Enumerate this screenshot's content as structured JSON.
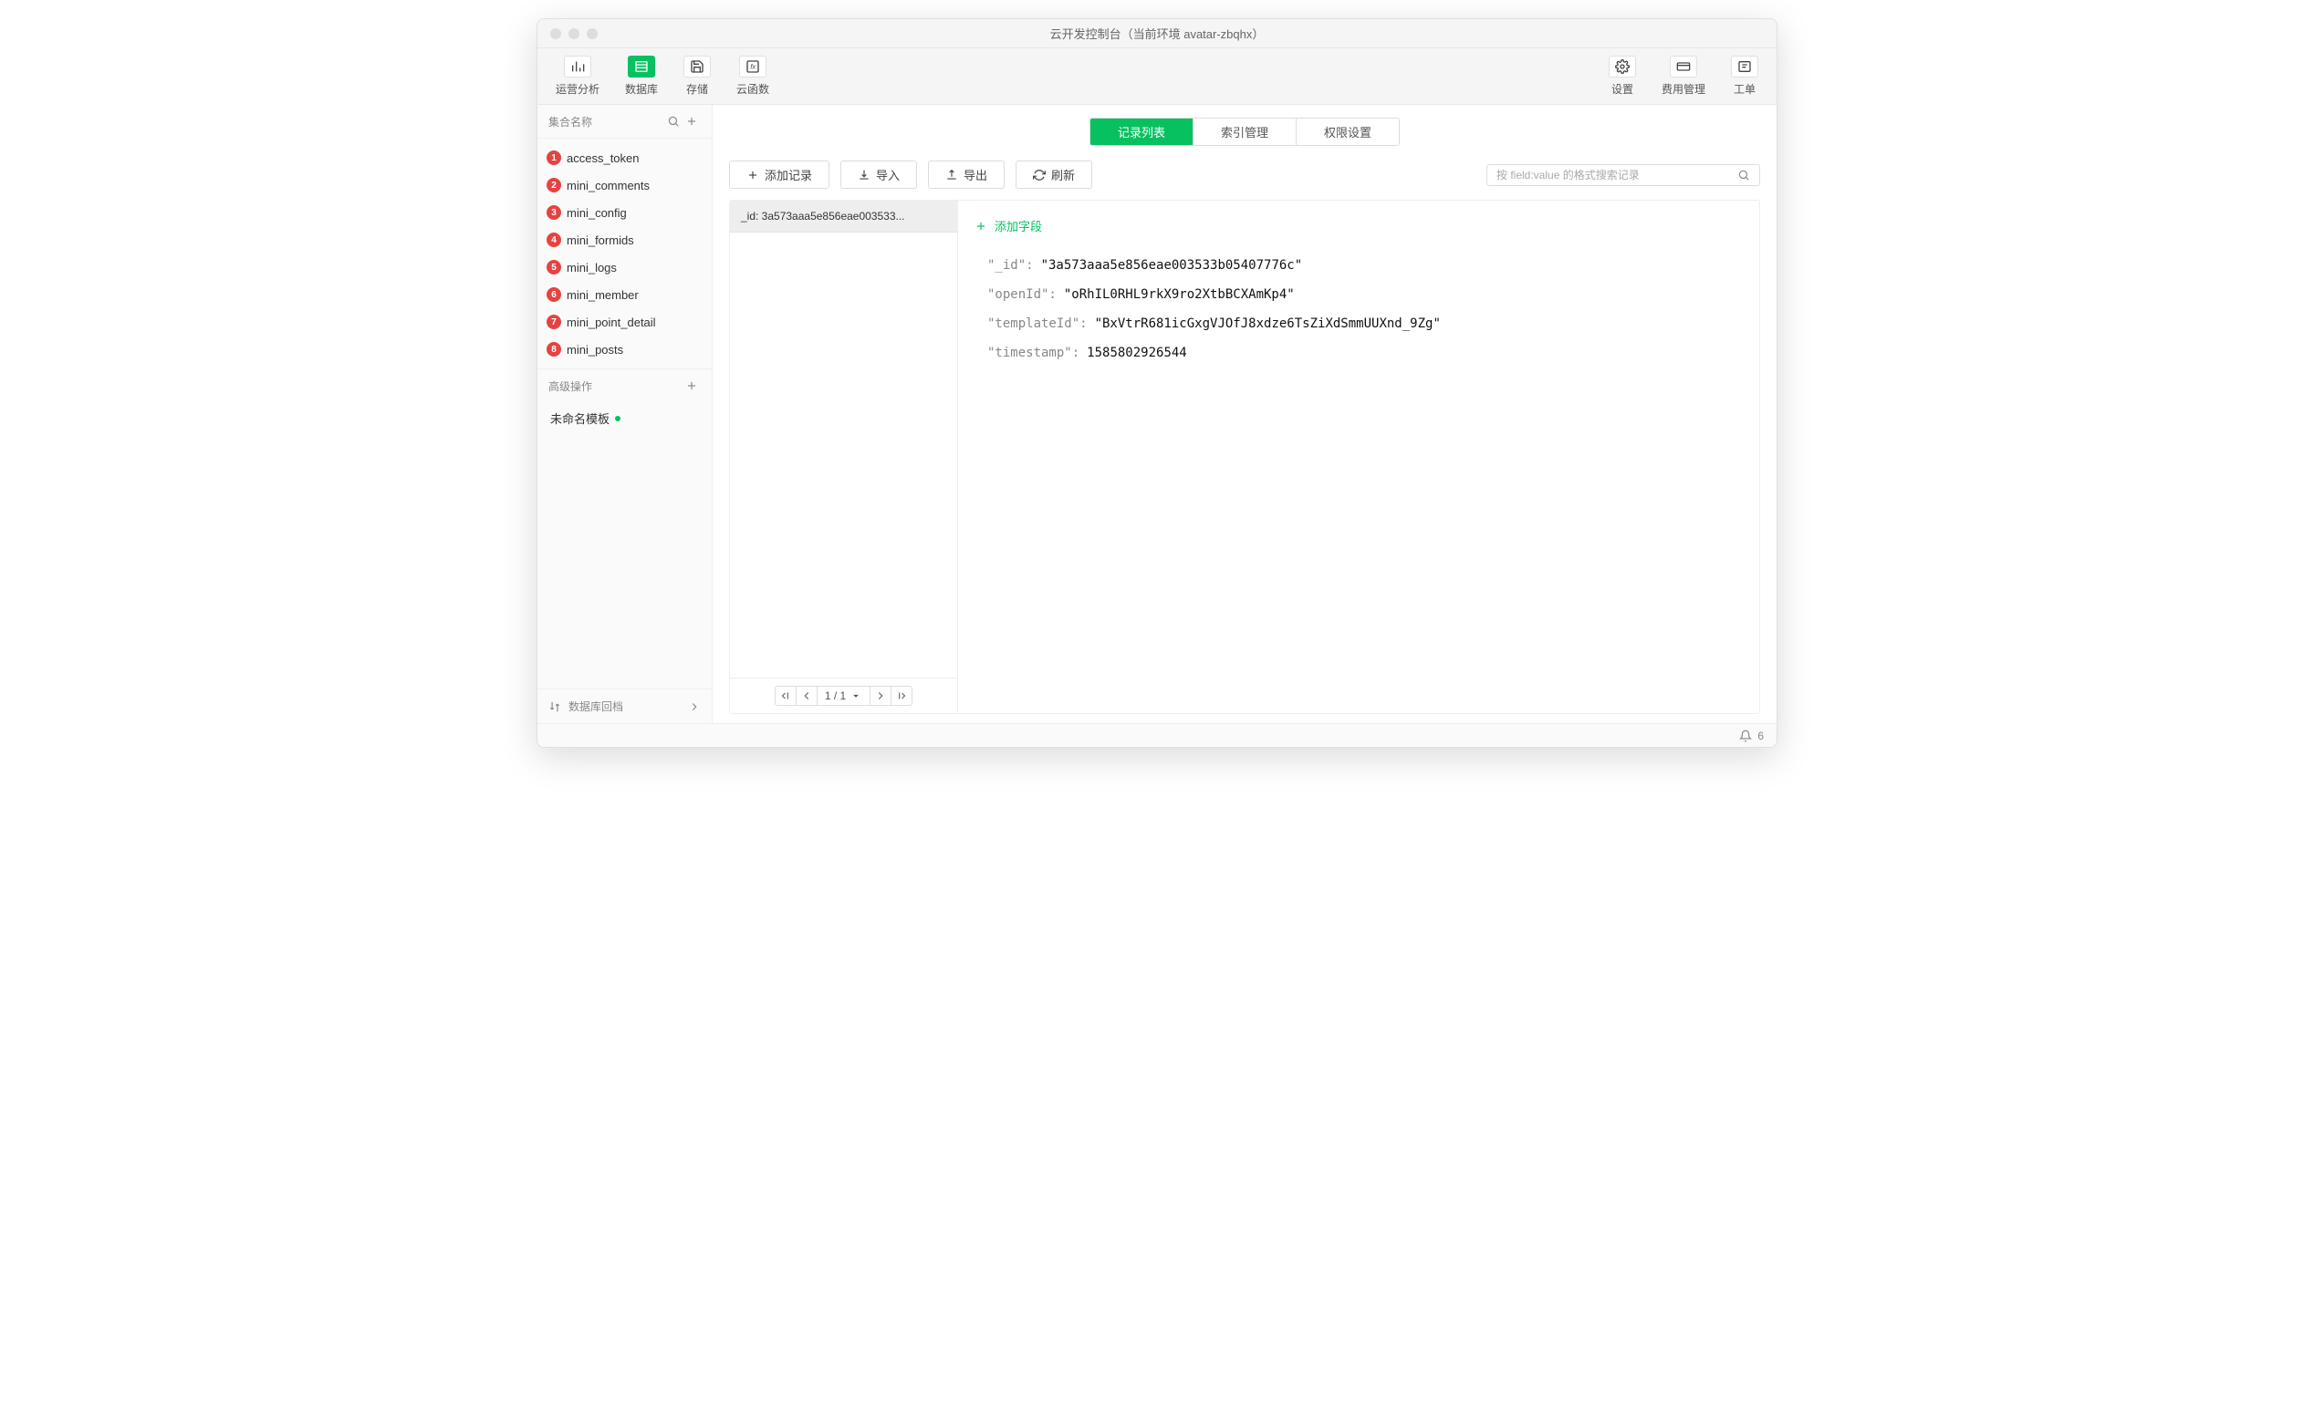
{
  "window": {
    "title": "云开发控制台（当前环境 avatar-zbqhx）"
  },
  "toolbar": {
    "left": [
      {
        "label": "运营分析",
        "icon": "chart-bar-icon",
        "active": false
      },
      {
        "label": "数据库",
        "icon": "database-icon",
        "active": true
      },
      {
        "label": "存储",
        "icon": "save-icon",
        "active": false
      },
      {
        "label": "云函数",
        "icon": "function-icon",
        "active": false
      }
    ],
    "right": [
      {
        "label": "设置",
        "icon": "settings-icon"
      },
      {
        "label": "费用管理",
        "icon": "billing-icon"
      },
      {
        "label": "工单",
        "icon": "ticket-icon"
      }
    ]
  },
  "sidebar": {
    "header_label": "集合名称",
    "collections": [
      {
        "num": "1",
        "name": "access_token"
      },
      {
        "num": "2",
        "name": "mini_comments"
      },
      {
        "num": "3",
        "name": "mini_config"
      },
      {
        "num": "4",
        "name": "mini_formids"
      },
      {
        "num": "5",
        "name": "mini_logs"
      },
      {
        "num": "6",
        "name": "mini_member"
      },
      {
        "num": "7",
        "name": "mini_point_detail"
      },
      {
        "num": "8",
        "name": "mini_posts"
      }
    ],
    "advanced_label": "高级操作",
    "templates": [
      {
        "name": "未命名模板"
      }
    ],
    "footer_label": "数据库回档"
  },
  "tabs": [
    {
      "label": "记录列表",
      "active": true
    },
    {
      "label": "索引管理",
      "active": false
    },
    {
      "label": "权限设置",
      "active": false
    }
  ],
  "actions": {
    "add_record": "添加记录",
    "import": "导入",
    "export": "导出",
    "refresh": "刷新",
    "search_placeholder": "按 field:value 的格式搜索记录"
  },
  "records": [
    {
      "label": "_id: 3a573aaa5e856eae003533..."
    }
  ],
  "pager": {
    "page_text": "1 / 1"
  },
  "detail": {
    "add_field_label": "添加字段",
    "fields": [
      {
        "key": "\"_id\":",
        "value": "\"3a573aaa5e856eae003533b05407776c\"",
        "type": "str"
      },
      {
        "key": "\"openId\":",
        "value": "\"oRhIL0RHL9rkX9ro2XtbBCXAmKp4\"",
        "type": "str"
      },
      {
        "key": "\"templateId\":",
        "value": "\"BxVtrR681icGxgVJOfJ8xdze6TsZiXdSmmUUXnd_9Zg\"",
        "type": "str"
      },
      {
        "key": "\"timestamp\":",
        "value": "1585802926544",
        "type": "num"
      }
    ]
  },
  "statusbar": {
    "notifications": "6"
  }
}
